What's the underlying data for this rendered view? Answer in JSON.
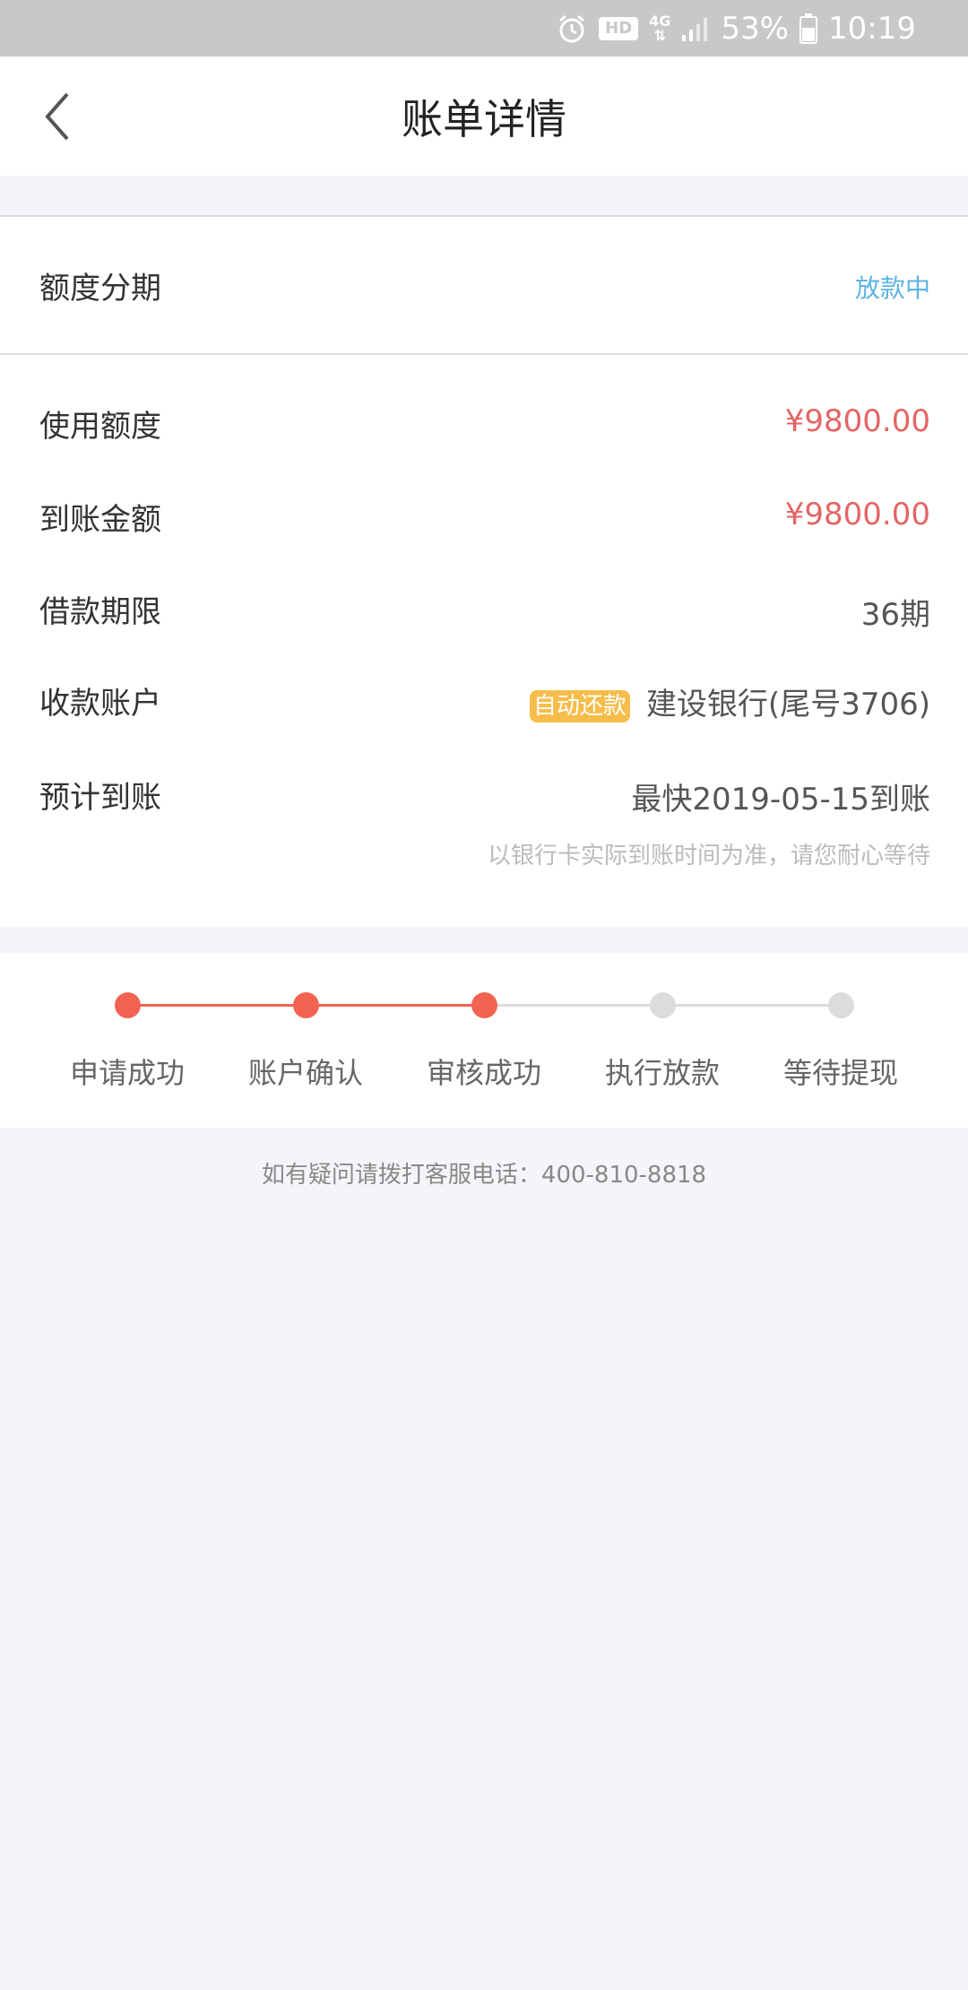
{
  "status_bar": {
    "hd": "HD",
    "network": "4G",
    "battery": "53%",
    "time": "10:19",
    "icons": [
      "alarm-icon",
      "hd-icon",
      "network-4g-icon",
      "signal-icon",
      "battery-icon"
    ]
  },
  "header": {
    "title": "账单详情",
    "back_icon": "chevron-left-icon"
  },
  "type_row": {
    "label": "额度分期",
    "status": "放款中"
  },
  "details": {
    "used_limit_label": "使用额度",
    "used_limit_value": "¥9800.00",
    "received_label": "到账金额",
    "received_value": "¥9800.00",
    "term_label": "借款期限",
    "term_value": "36期",
    "account_label": "收款账户",
    "account_tag": "自动还款",
    "account_value": "建设银行(尾号3706)",
    "eta_label": "预计到账",
    "eta_value": "最快2019-05-15到账",
    "eta_note": "以银行卡实际到账时间为准，请您耐心等待"
  },
  "progress": {
    "steps": [
      {
        "label": "申请成功",
        "done": true
      },
      {
        "label": "账户确认",
        "done": true
      },
      {
        "label": "审核成功",
        "done": true
      },
      {
        "label": "执行放款",
        "done": false
      },
      {
        "label": "等待提现",
        "done": false
      }
    ],
    "active_color": "#f26451",
    "inactive_color": "#dcdcdc"
  },
  "footer": {
    "note": "如有疑问请拨打客服电话：400-810-8818"
  },
  "colors": {
    "amount": "#e46565",
    "status": "#5cb3e6",
    "tag_bg": "#f6bd4b",
    "status_bar_bg": "#c8c8c8"
  }
}
